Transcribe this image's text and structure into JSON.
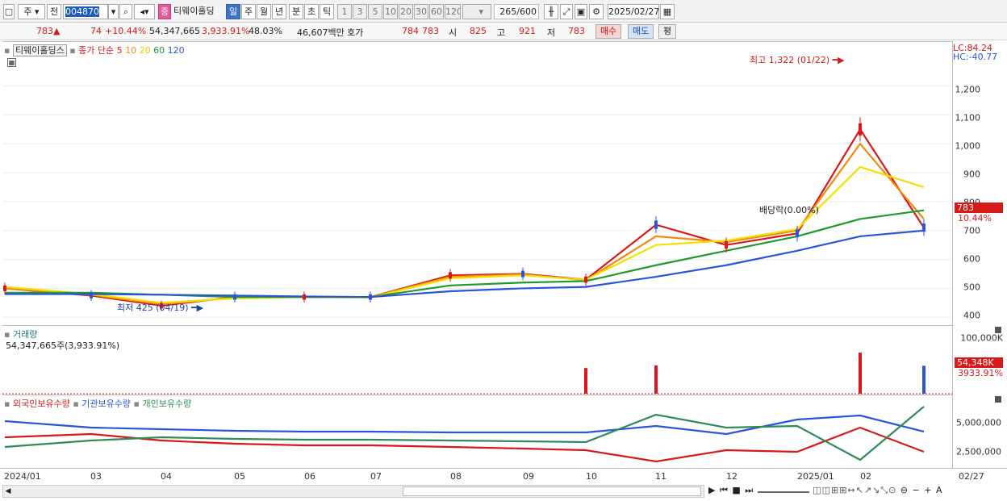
{
  "toolbar": {
    "market": "주",
    "period_type": "전",
    "code": "004870",
    "stock_badge": "증",
    "stock_name": "티웨이홀딩",
    "intervals": [
      "일",
      "주",
      "월",
      "년",
      "분",
      "초",
      "틱"
    ],
    "selected_interval": "일",
    "minutes": [
      "1",
      "3",
      "5",
      "10",
      "20",
      "30",
      "60",
      "120"
    ],
    "count": "265",
    "count_max": "/600",
    "date": "2025/02/27"
  },
  "quote": {
    "price": "783",
    "change": "74",
    "change_pct": "+10.44%",
    "volume": "54,347,665",
    "vol_pct": "3,933.91%",
    "turnover_rate": "48.03%",
    "amount": "46,607백만",
    "hoga_label": "호가",
    "ask": "784",
    "bid": "783",
    "open_label": "시",
    "open": "825",
    "high_label": "고",
    "high": "921",
    "low_label": "저",
    "low": "783",
    "buy_button": "매수",
    "sell_button": "매도",
    "eval_button": "평"
  },
  "price_panel": {
    "title": "티웨이홀딩스",
    "legend_prefix": "종가 단순",
    "ma": [
      {
        "label": "5",
        "color": "#d81919"
      },
      {
        "label": "10",
        "color": "#f08a12"
      },
      {
        "label": "20",
        "color": "#f2e000"
      },
      {
        "label": "60",
        "color": "#1e9a2e"
      },
      {
        "label": "120",
        "color": "#2a55d8"
      }
    ],
    "lc": "LC:84.24",
    "hc": "HC:-40.77",
    "high_note": "최고 1,322 (01/22)",
    "low_note": "최저 425 (04/19)",
    "dividend_note": "배당락(0.00%)",
    "price_tag": "783",
    "change_tag": "10.44%",
    "yticks": [
      "1,200",
      "1,100",
      "1,000",
      "900",
      "800",
      "700",
      "600",
      "500",
      "400"
    ]
  },
  "volume_panel": {
    "title": "거래량",
    "value_line": "54,347,665주(3,933.91%)",
    "ytick": "100,000K",
    "tag": "54,348K",
    "tag_pct": "3933.91%"
  },
  "holder_panel": {
    "legend": [
      {
        "label": "외국인보유수량",
        "color": "#d81919"
      },
      {
        "label": "기관보유수량",
        "color": "#2a55d8"
      },
      {
        "label": "개인보유수량",
        "color": "#2e8b57"
      }
    ],
    "yticks": [
      "5,000,000",
      "2,500,000"
    ]
  },
  "x_axis": [
    "2024/01",
    "03",
    "04",
    "05",
    "06",
    "07",
    "08",
    "09",
    "10",
    "11",
    "12",
    "2025/01",
    "02",
    "02/27"
  ],
  "chart_data": {
    "type": "line",
    "title": "티웨이홀딩스",
    "ylim": [
      370,
      1330
    ],
    "x": [
      "2024/01",
      "03",
      "04",
      "05",
      "06",
      "07",
      "08",
      "09",
      "10",
      "11",
      "12",
      "2025/01",
      "02",
      "02/27"
    ],
    "series": [
      {
        "name": "5",
        "values": [
          500,
          475,
          440,
          470,
          470,
          470,
          545,
          550,
          530,
          720,
          650,
          690,
          1050,
          710
        ]
      },
      {
        "name": "10",
        "values": [
          500,
          478,
          445,
          468,
          470,
          470,
          540,
          548,
          528,
          680,
          660,
          700,
          1000,
          740
        ]
      },
      {
        "name": "20",
        "values": [
          505,
          480,
          450,
          465,
          470,
          468,
          535,
          545,
          530,
          650,
          665,
          705,
          920,
          850
        ]
      },
      {
        "name": "60",
        "values": [
          485,
          485,
          478,
          470,
          470,
          470,
          510,
          520,
          525,
          580,
          630,
          680,
          740,
          770
        ]
      },
      {
        "name": "120",
        "values": [
          480,
          480,
          478,
          475,
          472,
          470,
          490,
          500,
          505,
          540,
          580,
          630,
          680,
          700
        ]
      }
    ],
    "volume_spikes": [
      {
        "x": "10",
        "value": 50000
      },
      {
        "x": "11",
        "value": 55000
      },
      {
        "x": "02",
        "value": 80000
      },
      {
        "x": "02/27",
        "value": 54348
      }
    ]
  }
}
